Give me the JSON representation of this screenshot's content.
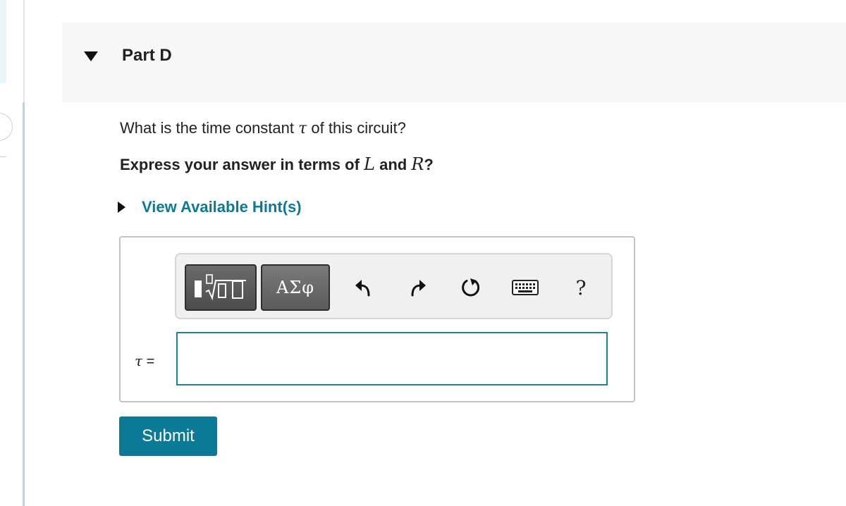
{
  "part": {
    "title": "Part D",
    "caret_icon": "caret-down-icon"
  },
  "question": {
    "prefix": "What is the time constant ",
    "symbol": "τ",
    "suffix": " of this circuit?"
  },
  "instruction": {
    "prefix": "Express your answer in terms of ",
    "var1": "L",
    "middle": " and ",
    "var2": "R",
    "suffix": "?"
  },
  "hint": {
    "label": "View Available Hint(s)",
    "caret_icon": "caret-right-icon"
  },
  "toolbar": {
    "templates_icon": "math-templates-icon",
    "greek_label": "ΑΣφ",
    "undo_icon": "undo-icon",
    "redo_icon": "redo-icon",
    "reset_icon": "reset-icon",
    "keyboard_icon": "keyboard-icon",
    "help_label": "?"
  },
  "answer": {
    "symbol": "τ",
    "equals": " =",
    "value": "",
    "placeholder": ""
  },
  "submit": {
    "label": "Submit"
  },
  "colors": {
    "accent": "#0a7a97",
    "input_border": "#1f7ea1",
    "header_bg": "#f7f7f7"
  }
}
